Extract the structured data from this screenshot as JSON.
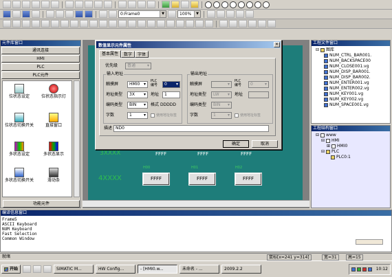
{
  "toolbar": {
    "frame_combo": "0:Frame0",
    "zoom_combo": "100%"
  },
  "lib_window": {
    "title": "元件库窗口",
    "tabs": [
      "通讯连接",
      "HMI",
      "PLC",
      "PLC元件"
    ],
    "items": [
      "位状态设定",
      "位状态指示灯",
      "位状态切换开关",
      "直接窗口",
      "多状态设定",
      "多状态显示",
      "多状态切换开关",
      "滑动条"
    ],
    "footer": "功能元件"
  },
  "canvas": {
    "labels": [
      "H00",
      "H01",
      "H02"
    ],
    "xxx_label": "4XXXX",
    "xxx_label_top": "3XXXX",
    "button_text": "FFFF",
    "top_values": [
      "FFFF",
      "FFFF",
      "FFFF"
    ]
  },
  "dialog": {
    "title": "数值显示元件属性",
    "tabs": [
      "基本属性",
      "数字",
      "字体"
    ],
    "priority_label": "优先级",
    "priority_value": "普通",
    "input_group": "输入地址",
    "output_group": "输出地址",
    "touch_label": "触摸屏",
    "touch_value": "HMI0",
    "plc_no_label": "PLC编号",
    "plc_no_value": "0",
    "addr_type_label": "地址类型",
    "addr_type_value": "3X",
    "addr_label": "地址",
    "addr_value": "1",
    "code_label": "编码类型",
    "code_value": "BIN",
    "format_label": "格式",
    "format_value": "DDDDD",
    "words_label": "字数",
    "words_value": "1",
    "use_label_chk": "使用地址标签",
    "out_addr_type_value": "LW",
    "out_code_value": "BIN",
    "out_words_value": "1",
    "desc_label": "描述",
    "desc_value": "ND0",
    "ok_button": "确定",
    "cancel_button": "取消"
  },
  "file_window": {
    "title": "工程文件窗口",
    "root": "图库",
    "files": [
      "NUM_CTRL_BAR001.",
      "NUM_BACKSPACE00",
      "NUM_CLOSE001.vg",
      "NUM_DISP_BAR001.",
      "NUM_DISP_BAR002.",
      "NUM_ENTER001.vg",
      "NUM_ENTER002.vg",
      "NUM_KEY001.vg",
      "NUM_KEY002.vg",
      "NUM_SPACE001.vg"
    ]
  },
  "struct_window": {
    "title": "工程结构窗口",
    "items": [
      "www",
      "HMI",
      "HMI0",
      "PLC",
      "PLC0:1"
    ]
  },
  "compile_window": {
    "title": "编译信息窗口",
    "lines": [
      "Frame5",
      "ASCII Keyboard",
      "NUM Keyboard",
      "Fast Selection",
      "Common Window"
    ]
  },
  "status_bar": {
    "ready": "就绪",
    "coords": "鼠标[x=241 y=314]",
    "width": "宽=31",
    "height": "高=15"
  },
  "taskbar": {
    "start": "开始",
    "tasks": [
      "SIMATIC M...",
      "HW Config...",
      "- [HMI0.w...",
      "未命名 - ...",
      "2009.2.2"
    ],
    "clock": "10:12"
  }
}
